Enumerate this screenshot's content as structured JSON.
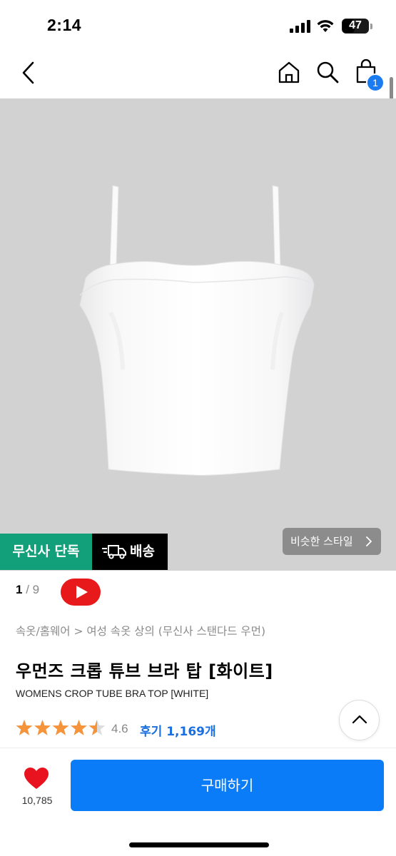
{
  "status_bar": {
    "time": "2:14",
    "battery_level": "47",
    "battery_fraction": 0.47
  },
  "header": {
    "back_icon": "chevron-left-icon",
    "home_icon": "home-icon",
    "search_icon": "search-icon",
    "cart_icon": "shopping-bag-icon",
    "cart_count": "1"
  },
  "product_image": {
    "tags": {
      "exclusive": "무신사 단독",
      "delivery": "배송"
    },
    "similar_style_label": "비슷한 스타일"
  },
  "gallery": {
    "current": "1",
    "separator": "/",
    "total": "9"
  },
  "product": {
    "breadcrumb": "속옷/홈웨어 > 여성 속옷 상의 (무신사 스탠다드 우먼)",
    "title": "우먼즈 크롭 튜브 브라 탑 [화이트]",
    "subtitle": "WOMENS CROP TUBE BRA TOP [WHITE]",
    "rating": "4.6",
    "rating_stars": 4.5,
    "reviews_label": "후기 1,169개"
  },
  "bottom_bar": {
    "like_count": "10,785",
    "buy_label": "구매하기"
  },
  "colors": {
    "accent_blue": "#0a7cf7",
    "exclusive_green": "#12a07a",
    "star_orange": "#f5943a",
    "heart_red": "#e8131f",
    "youtube_red": "#e8191a"
  }
}
